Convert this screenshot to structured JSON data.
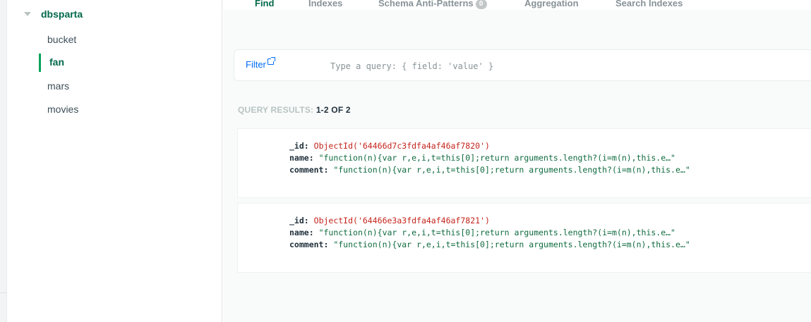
{
  "sidebar": {
    "database": "dbsparta",
    "collections": [
      "bucket",
      "fan",
      "mars",
      "movies"
    ],
    "active_collection": "fan"
  },
  "tabs": [
    {
      "label": "Find",
      "active": true
    },
    {
      "label": "Indexes"
    },
    {
      "label": "Schema Anti-Patterns",
      "badge": "0"
    },
    {
      "label": "Aggregation"
    },
    {
      "label": "Search Indexes"
    }
  ],
  "filter": {
    "label": "Filter",
    "placeholder": "Type a query: { field: 'value' }"
  },
  "results": {
    "label": "QUERY RESULTS:",
    "count": "1-2 OF 2"
  },
  "documents": [
    {
      "id_key": "_id:",
      "id_value": "ObjectId('64466d7c3fdfa4af46af7820')",
      "name_key": "name:",
      "name_value": "\"function(n){var r,e,i,t=this[0];return arguments.length?(i=m(n),this.e…\"",
      "comment_key": "comment:",
      "comment_value": "\"function(n){var r,e,i,t=this[0];return arguments.length?(i=m(n),this.e…\""
    },
    {
      "id_key": "_id:",
      "id_value": "ObjectId('64466e3a3fdfa4af46af7821')",
      "name_key": "name:",
      "name_value": "\"function(n){var r,e,i,t=this[0];return arguments.length?(i=m(n),this.e…\"",
      "comment_key": "comment:",
      "comment_value": "\"function(n){var r,e,i,t=this[0];return arguments.length?(i=m(n),this.e…\""
    }
  ],
  "colors": {
    "brand_green": "#00684a",
    "active_indicator": "#00a35c",
    "link_blue": "#016bf8",
    "objectid_red": "#c4251c",
    "string_green": "#0f6b3f"
  },
  "icons": [
    "caret-down-icon",
    "external-link-icon"
  ]
}
